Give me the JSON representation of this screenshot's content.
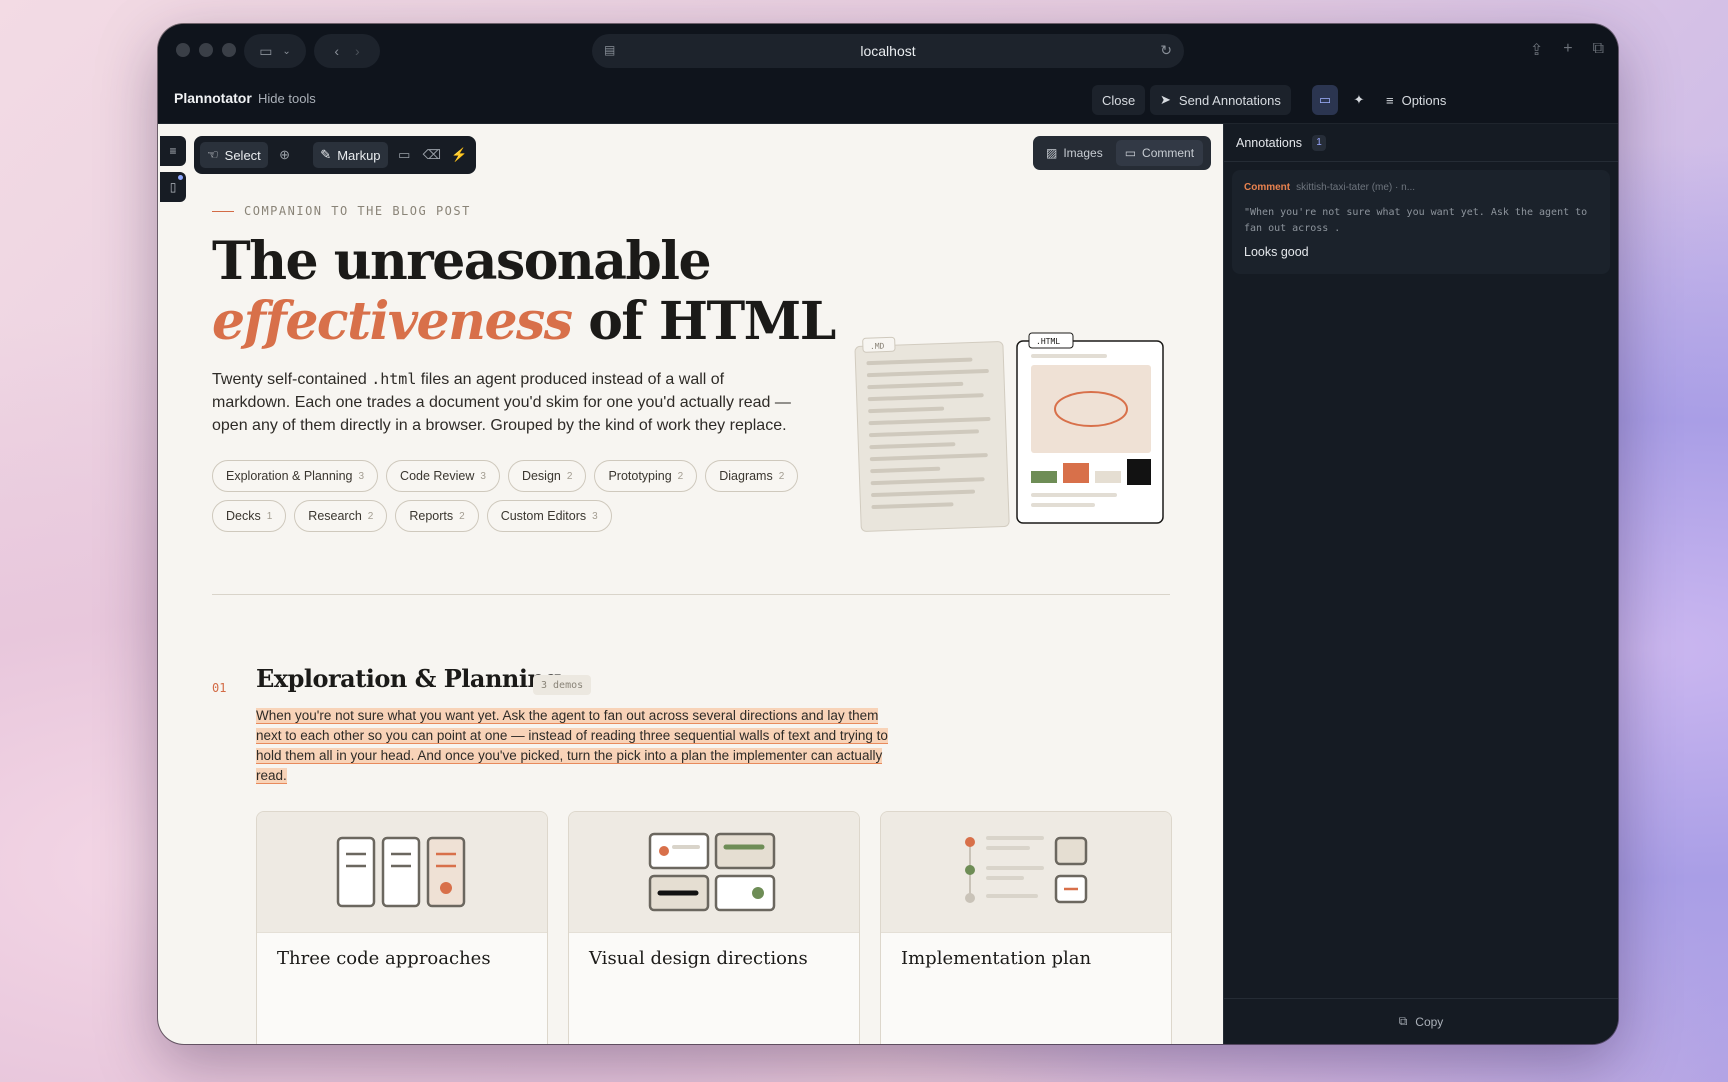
{
  "browser": {
    "url": "localhost"
  },
  "header": {
    "brand": "Plannotator",
    "hide_tools": "Hide tools",
    "close": "Close",
    "send": "Send Annotations",
    "options": "Options"
  },
  "toolbar": {
    "select": "Select",
    "markup": "Markup"
  },
  "viewbar": {
    "images": "Images",
    "comment": "Comment"
  },
  "hero": {
    "eyebrow": "COMPANION TO THE BLOG POST",
    "title_line1": "The unreasonable",
    "title_accent": "effectiveness",
    "title_rest": " of HTML",
    "desc_before": "Twenty self-contained ",
    "desc_code": ".html",
    "desc_after": " files an agent produced instead of a wall of markdown. Each one trades a document you'd skim for one you'd actually read — open any of them directly in a browser. Grouped by the kind of work they replace.",
    "md_label": ".MD",
    "html_label": ".HTML"
  },
  "chips": [
    {
      "label": "Exploration & Planning",
      "count": "3"
    },
    {
      "label": "Code Review",
      "count": "3"
    },
    {
      "label": "Design",
      "count": "2"
    },
    {
      "label": "Prototyping",
      "count": "2"
    },
    {
      "label": "Diagrams",
      "count": "2"
    },
    {
      "label": "Decks",
      "count": "1"
    },
    {
      "label": "Research",
      "count": "2"
    },
    {
      "label": "Reports",
      "count": "2"
    },
    {
      "label": "Custom Editors",
      "count": "3"
    }
  ],
  "section": {
    "number": "01",
    "title": "Exploration & Planning",
    "badge": "3 demos",
    "desc": "When you're not sure what you want yet. Ask the agent to fan out across several directions and lay them next to each other so you can point at one — instead of reading three sequential walls of text and trying to hold them all in your head. And once you've picked, turn the pick into a plan the implementer can actually read."
  },
  "cards": [
    {
      "title": "Three code approaches"
    },
    {
      "title": "Visual design directions"
    },
    {
      "title": "Implementation plan"
    }
  ],
  "panel": {
    "title": "Annotations",
    "count": "1",
    "annotation": {
      "type": "Comment",
      "author": "skittish-taxi-tater (me) · n...",
      "quote": "\"When you're not sure what you want yet. Ask the agent to fan out across .",
      "text": "Looks good"
    },
    "copy": "Copy"
  },
  "colors": {
    "accent": "#d8704a",
    "highlight": "#f8d3b8",
    "dark_bg": "#0f141c",
    "paper": "#f7f5f1"
  }
}
